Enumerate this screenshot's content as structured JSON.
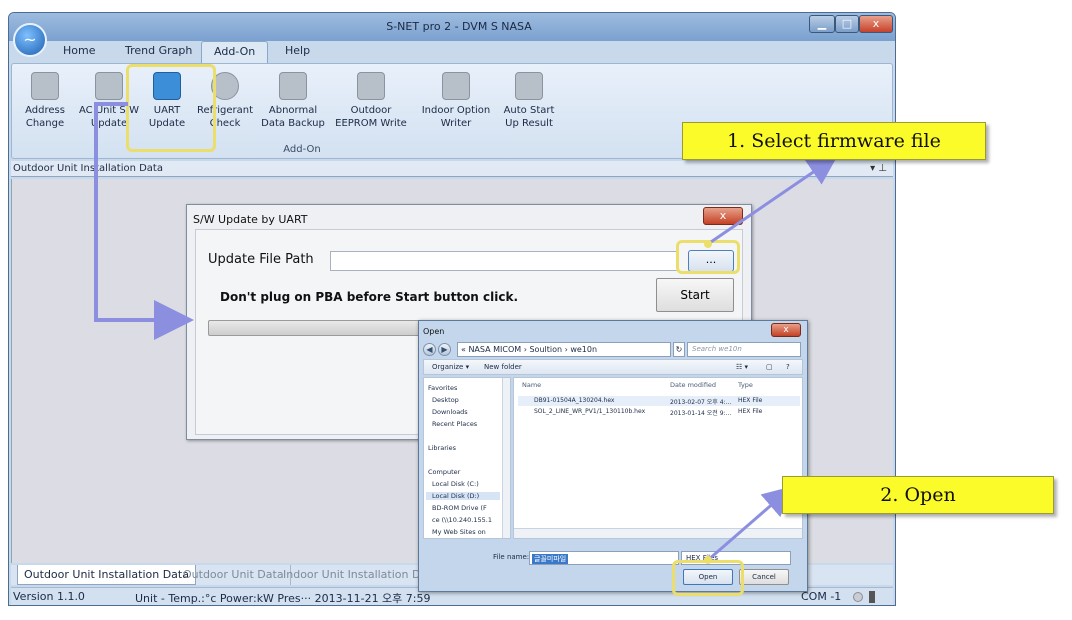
{
  "window": {
    "title": "S-NET pro 2 - DVM S NASA",
    "app_icon": "pulse-icon",
    "controls": {
      "minimize": "▁",
      "maximize": "□",
      "close": "x"
    }
  },
  "menu": {
    "tabs": [
      "Home",
      "Trend Graph",
      "Add-On",
      "Help"
    ],
    "active": "Add-On"
  },
  "ribbon": {
    "group_label": "Add-On",
    "buttons": [
      {
        "line1": "Address",
        "line2": "Change",
        "icon": "address-change-icon"
      },
      {
        "line1": "AC Unit S/W",
        "line2": "Update",
        "icon": "sync-arrows-icon"
      },
      {
        "line1": "UART",
        "line2": "Update",
        "icon": "uart-chip-icon"
      },
      {
        "line1": "Refrigerant",
        "line2": "Check",
        "icon": "refrigerant-gauge-icon"
      },
      {
        "line1": "Abnormal",
        "line2": "Data Backup",
        "icon": "download-tray-icon"
      },
      {
        "line1": "Outdoor",
        "line2": "EEPROM Write",
        "icon": "eeprom-chip-icon"
      },
      {
        "line1": "Indoor Option",
        "line2": "Writer",
        "icon": "layers-icon"
      },
      {
        "line1": "Auto Start",
        "line2": "Up Result",
        "icon": "report-search-icon"
      }
    ]
  },
  "panel": {
    "title": "Outdoor Unit Installation Data",
    "pin": "▾ ⊥"
  },
  "bottom_tabs": [
    "Outdoor Unit Installation Data",
    "Outdoor Unit Data",
    "Indoor Unit Installation Data"
  ],
  "status": {
    "version": "Version 1.1.0",
    "units": "Unit - Temp.:°c   Power:kW   Pres··· 2013-11-21   오후 7:59",
    "com": "COM -1"
  },
  "uart_dialog": {
    "title": "S/W Update by UART",
    "close": "x",
    "path_label": "Update File Path",
    "path_value": "",
    "browse_label": "...",
    "warning": "Don't plug on PBA before Start button click.",
    "start_label": "Start"
  },
  "open_dialog": {
    "title": "Open",
    "close": "x",
    "address": "« NASA MICOM › Soultion › we10n",
    "search_placeholder": "Search we10n",
    "organize": "Organize ▾",
    "new_folder": "New folder",
    "sidebar": [
      "Favorites",
      "Desktop",
      "Downloads",
      "Recent Places",
      "Libraries",
      "Computer",
      "Local Disk (C:)",
      "Local Disk (D:)",
      "BD-ROM Drive (F",
      "ce (\\\\10.240.155.1",
      "My Web Sites on"
    ],
    "columns": [
      "Name",
      "Date modified",
      "Type"
    ],
    "files": [
      {
        "name": "DB91-01504A_130204.hex",
        "date": "2013-02-07 오후 4:...",
        "type": "HEX File"
      },
      {
        "name": "SOL_2_LINE_WR_PV1/1_130110b.hex",
        "date": "2013-01-14 오전 9:...",
        "type": "HEX File"
      }
    ],
    "filename_label": "File name:",
    "filename_value": "글꼴미파일",
    "filter_value": "HEX Files",
    "open_label": "Open",
    "cancel_label": "Cancel"
  },
  "annotations": {
    "callout1": "1. Select  firmware file",
    "callout2": "2. Open",
    "highlight_color": "#ecde6a",
    "arrow_color": "#8c8fe0",
    "callout_color": "#fbfb2a"
  }
}
